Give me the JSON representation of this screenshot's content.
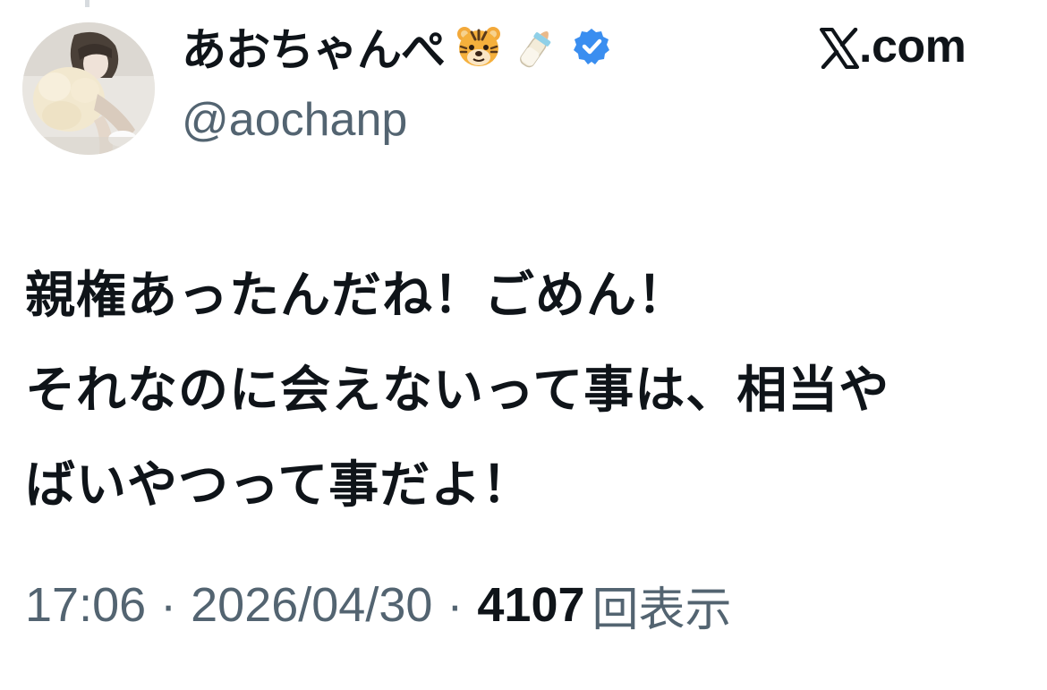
{
  "tweet": {
    "author": {
      "display_name": "あおちゃんぺ",
      "handle": "@aochanp",
      "name_emojis": [
        "tiger-face-emoji",
        "baby-bottle-emoji"
      ],
      "verified_icon": "verified-badge-icon",
      "verified_color": "#3a8ef0"
    },
    "brand": {
      "icon": "x-logo-icon",
      "text": ".com"
    },
    "text_lines": [
      "親権あったんだね！ごめん！",
      "それなのに会えないって事は、相当や",
      "ばいやつって事だよ！"
    ],
    "meta": {
      "time": "17:06",
      "separator": "·",
      "date": "2026/04/30",
      "views_count": "4107",
      "views_label": "回表示"
    }
  },
  "colors": {
    "text_primary": "#0f1419",
    "text_secondary": "#536471",
    "background": "#ffffff"
  }
}
